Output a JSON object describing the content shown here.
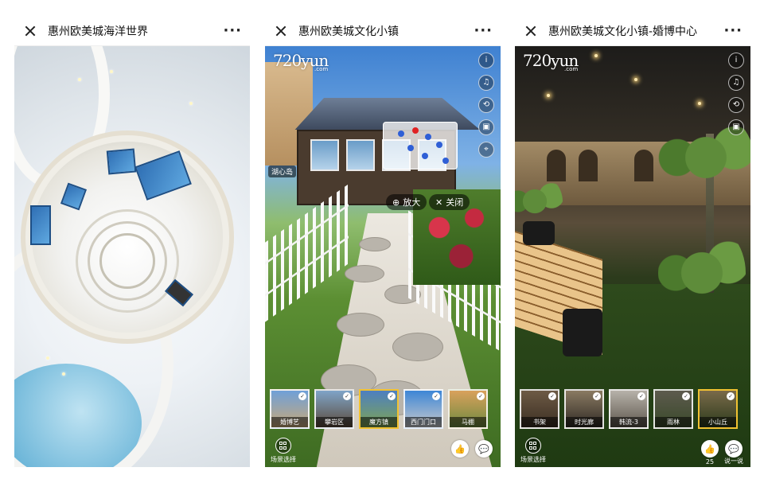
{
  "panels": [
    {
      "title": "惠州欧美城海洋世界",
      "colors": {
        "floor": "#6bb5d8",
        "walls": "#f2f2f0"
      }
    },
    {
      "title": "惠州欧美城文化小镇",
      "logo": "720yun",
      "logo_sub": ".com",
      "hotspot_label": "湖心岛",
      "map_buttons": {
        "zoom": "放大",
        "close": "关闭"
      },
      "thumbnails": [
        "婚博艺",
        "攀岩区",
        "魔方镇",
        "西门门口",
        "马棚"
      ],
      "active_thumbnail": 2,
      "like_count": "",
      "scene_select": "场景选择"
    },
    {
      "title": "惠州欧美城文化小镇-婚博中心",
      "logo": "720yun",
      "logo_sub": ".com",
      "thumbnails": [
        "书架",
        "时光廊",
        "韩流-3",
        "雨林",
        "小山丘"
      ],
      "active_thumbnail": 4,
      "like_count": "25",
      "comment_label": "说一说",
      "scene_select": "场景选择"
    }
  ],
  "icons": [
    "close-icon",
    "more-icon",
    "info-icon",
    "music-icon",
    "gyro-icon",
    "vr-icon",
    "location-icon",
    "like-icon",
    "comment-icon",
    "scene-grid-icon",
    "zoom-icon"
  ]
}
